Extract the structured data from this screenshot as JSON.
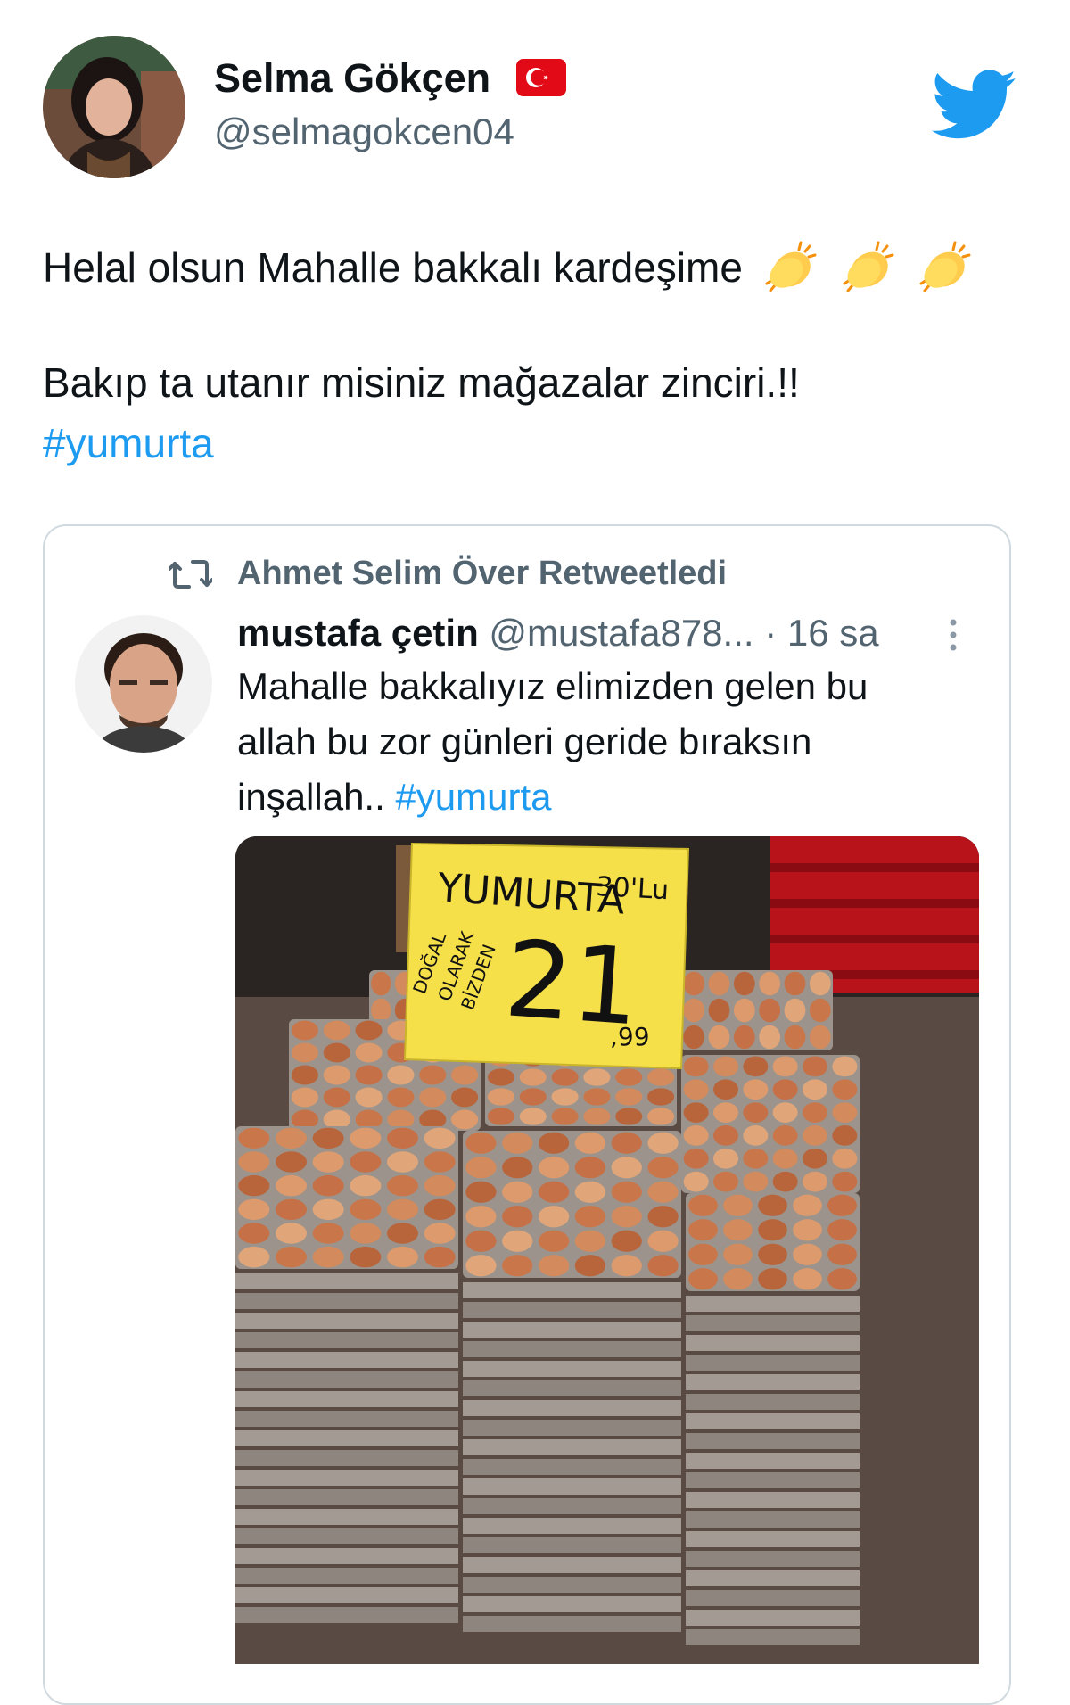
{
  "author": {
    "name": "Selma Gökçen",
    "handle": "@selmagokcen04",
    "flag_icon": "turkey-flag-icon",
    "avatar_icon": "user-avatar"
  },
  "brand_icon": "twitter-bird-icon",
  "tweet": {
    "line1": "Helal olsun Mahalle bakkalı kardeşime",
    "emoji": [
      "clapping-hands-icon",
      "clapping-hands-icon",
      "clapping-hands-icon"
    ],
    "line2": "Bakıp ta utanır misiniz mağazalar zinciri.!!",
    "hashtag": "#yumurta"
  },
  "quoted": {
    "retweet_label": "Ahmet Selim Över Retweetledi",
    "author_name": "mustafa çetin",
    "author_handle": "@mustafa878...",
    "time": "· 16 sa",
    "text_line1": "Mahalle bakkalıyız elimizden gelen bu",
    "text_line2": "allah bu zor günleri geride bıraksın",
    "text_line3": "inşallah..",
    "hashtag": "#yumurta",
    "photo": {
      "sign_title": "YUMURTA",
      "sign_count": "30'Lu",
      "sign_side": [
        "DOĞAL",
        "OLARAK",
        "BİZDEN"
      ],
      "sign_price": "21",
      "sign_cents": ",99"
    }
  },
  "colors": {
    "accent": "#1d9bf0",
    "muted": "#536471",
    "sign_yellow": "#f5e04a",
    "egg_brown": "#c9774a"
  }
}
